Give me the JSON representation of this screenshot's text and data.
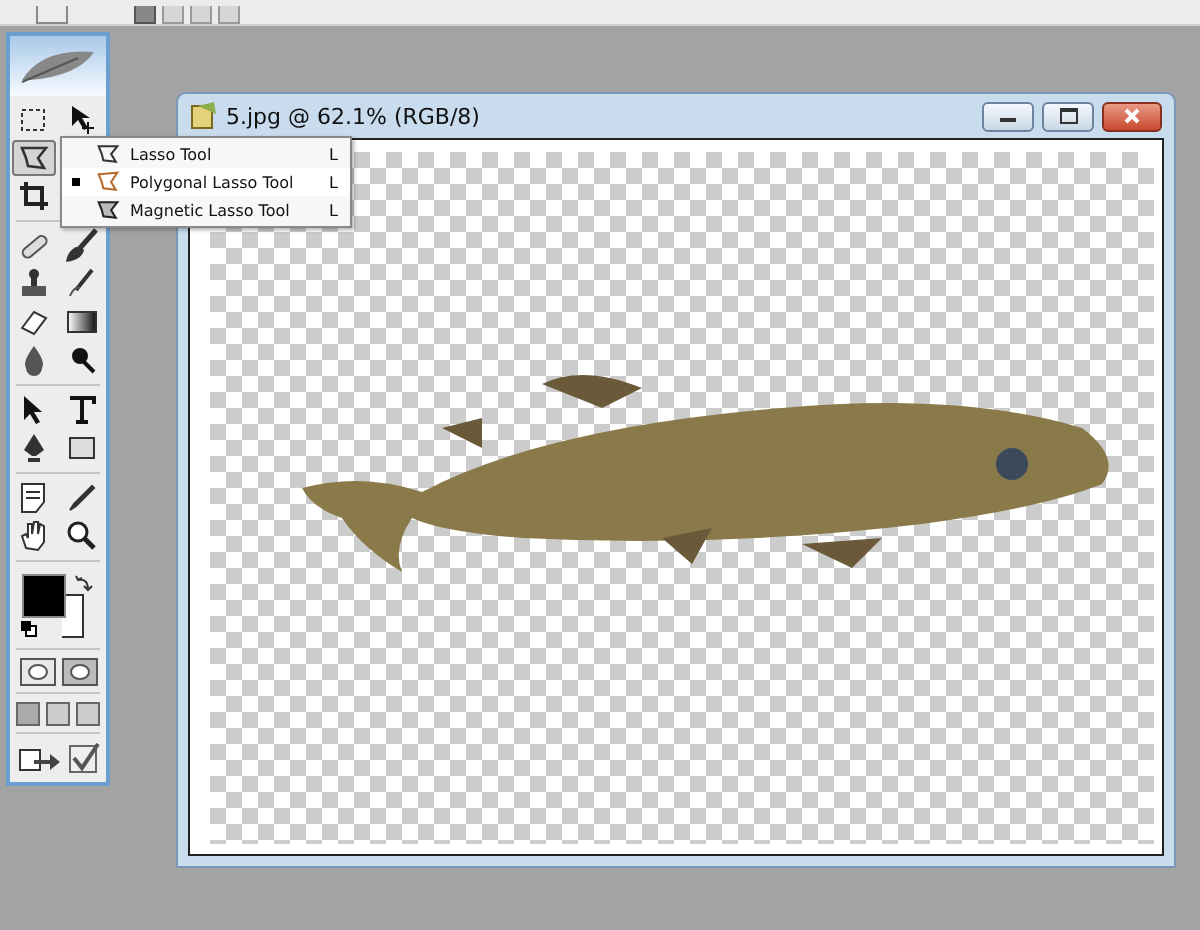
{
  "toolbox": {
    "groups": [
      [
        {
          "kind": "marquee",
          "selected": false
        },
        {
          "kind": "move",
          "selected": false
        },
        {
          "kind": "lasso",
          "selected": true
        },
        {
          "kind": "crop",
          "selected": false
        }
      ],
      [
        {
          "kind": "healing",
          "selected": false
        },
        {
          "kind": "brush",
          "selected": false
        },
        {
          "kind": "stamp",
          "selected": false
        },
        {
          "kind": "history",
          "selected": false
        },
        {
          "kind": "eraser",
          "selected": false
        },
        {
          "kind": "gradient",
          "selected": false
        },
        {
          "kind": "blur",
          "selected": false
        },
        {
          "kind": "dodge",
          "selected": false
        }
      ],
      [
        {
          "kind": "arrow",
          "selected": false
        },
        {
          "kind": "type",
          "selected": false
        },
        {
          "kind": "pen",
          "selected": false
        },
        {
          "kind": "shape",
          "selected": false
        }
      ],
      [
        {
          "kind": "notes",
          "selected": false
        },
        {
          "kind": "eyedropper",
          "selected": false
        },
        {
          "kind": "hand",
          "selected": false
        },
        {
          "kind": "zoom",
          "selected": false
        }
      ]
    ]
  },
  "flyout": {
    "items": [
      {
        "label": "Lasso Tool",
        "shortcut": "L",
        "kind": "lasso",
        "selected": false
      },
      {
        "label": "Polygonal Lasso Tool",
        "shortcut": "L",
        "kind": "polygon",
        "selected": true
      },
      {
        "label": "Magnetic Lasso Tool",
        "shortcut": "L",
        "kind": "magnetic",
        "selected": false
      }
    ]
  },
  "document": {
    "title": "5.jpg @ 62.1% (RGB/8)"
  }
}
